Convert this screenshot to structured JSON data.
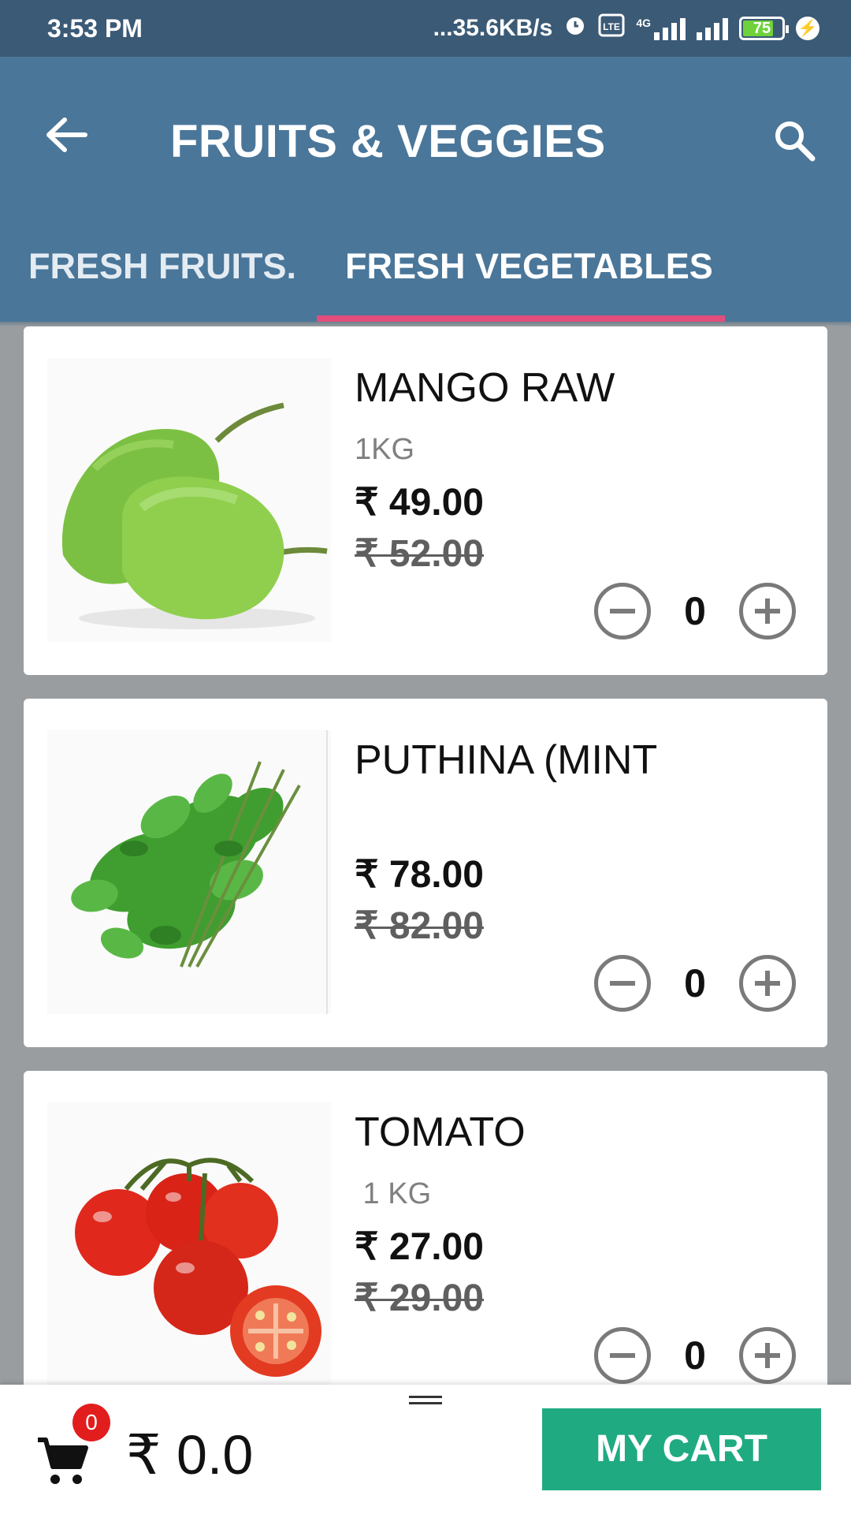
{
  "status_bar": {
    "time": "3:53 PM",
    "net_speed": "...35.6KB/s",
    "network": "4G",
    "battery": "75"
  },
  "toolbar": {
    "title": "FRUITS & VEGGIES"
  },
  "tabs": [
    {
      "label": "FRESH FRUITS.",
      "selected": false
    },
    {
      "label": "FRESH VEGETABLES",
      "selected": true
    }
  ],
  "accent_colors": {
    "toolbar": "#4a7699",
    "tab_indicator": "#e14e7c",
    "cart_button": "#1faa82",
    "badge": "#e21d1d"
  },
  "products": [
    {
      "name": "MANGO RAW",
      "unit": "1KG",
      "price": "₹ 49.00",
      "mrp": "₹ 52.00",
      "qty": "0",
      "image": "raw-mango-image"
    },
    {
      "name": "PUTHINA (MINT",
      "unit": "",
      "price": "₹ 78.00",
      "mrp": "₹ 82.00",
      "qty": "0",
      "image": "mint-image"
    },
    {
      "name": "TOMATO",
      "unit": " 1 KG",
      "price": "₹ 27.00",
      "mrp": "₹ 29.00",
      "qty": "0",
      "image": "tomato-image"
    }
  ],
  "bottom_bar": {
    "cart_count": "0",
    "total": "₹ 0.0",
    "cart_button": "MY CART"
  }
}
